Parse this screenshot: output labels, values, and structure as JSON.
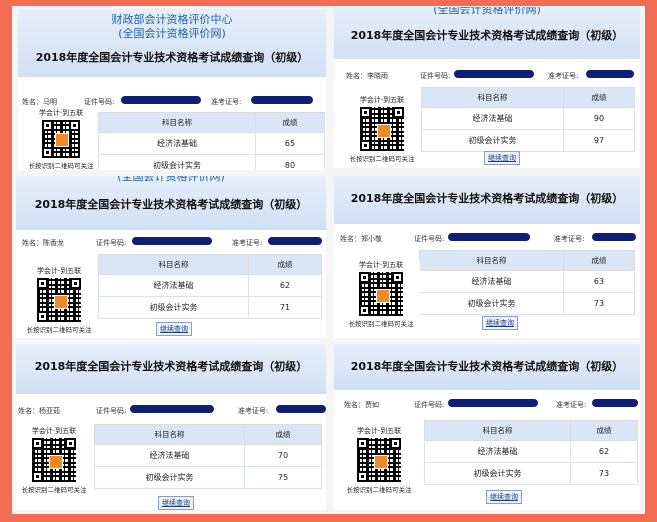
{
  "common": {
    "title": "2018年度全国会计专业技术资格考试成绩查询（初级）",
    "org_line1": "财政部会计资格评价中心",
    "org_line2": "(全国会计资格评价网)",
    "org_partial": "(全国会计资格评价网)",
    "label_name": "姓名：",
    "label_id": "证件号码:",
    "label_ticket": "准考证号:",
    "col_subject": "科目名称",
    "col_score": "成绩",
    "subject_1": "经济法基础",
    "subject_2": "初级会计实务",
    "qr_top": "学会计·到五联",
    "qr_bottom": "长按识别二维码可关注",
    "continue_btn": "继续查询"
  },
  "colors": {
    "background": "#f26d54",
    "redaction": "#0f1f73",
    "header": "#cfe0f3"
  },
  "panels": [
    {
      "name": "马明",
      "score_1": "65",
      "score_2": "80"
    },
    {
      "name": "李晓雨",
      "score_1": "90",
      "score_2": "97"
    },
    {
      "name": "陈香龙",
      "score_1": "62",
      "score_2": "71"
    },
    {
      "name": "郑小敬",
      "score_1": "63",
      "score_2": "73"
    },
    {
      "name": "杨亚茹",
      "score_1": "70",
      "score_2": "75"
    },
    {
      "name": "贾如",
      "score_1": "62",
      "score_2": "73"
    }
  ]
}
